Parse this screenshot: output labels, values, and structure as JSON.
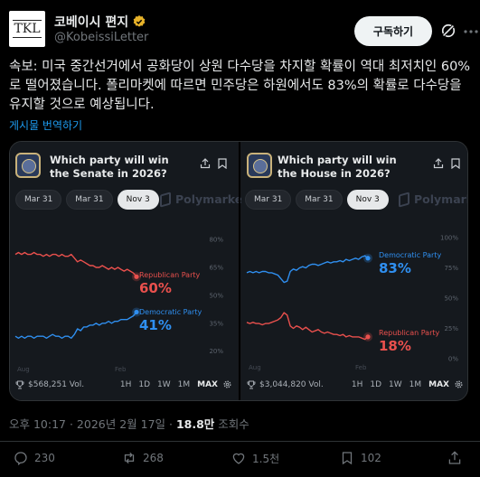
{
  "author": {
    "avatar_text": "TKL",
    "display_name": "코베이시 편지",
    "handle": "@KobeissiLetter"
  },
  "follow_label": "구독하기",
  "tweet_text": "속보: 미국 중간선거에서 공화당이 상원 다수당을 차지할 확률이 역대 최저치인 60%로 떨어졌습니다. 폴리마켓에 따르면 민주당은 하원에서도 83%의 확률로 다수당을 유지할 것으로 예상됩니다.",
  "translate_label": "게시물 번역하기",
  "colors": {
    "republican": "#e9504d",
    "democratic": "#2f8ff0",
    "accent": "#1d9bf0"
  },
  "panels": [
    {
      "title": "Which party will win the Senate in 2026?",
      "pills": [
        "Mar 31",
        "Mar 31",
        "Nov 3"
      ],
      "active_pill": 2,
      "brand": "Polymarket",
      "volume": "$568,251 Vol.",
      "ranges": [
        "1H",
        "1D",
        "1W",
        "1M",
        "MAX"
      ],
      "active_range": "MAX"
    },
    {
      "title": "Which party will win the House in 2026?",
      "pills": [
        "Mar 31",
        "Mar 31",
        "Nov 3"
      ],
      "active_pill": 2,
      "brand": "Polymarket",
      "volume": "$3,044,820 Vol.",
      "ranges": [
        "1H",
        "1D",
        "1W",
        "1M",
        "MAX"
      ],
      "active_range": "MAX"
    }
  ],
  "chart_data": [
    {
      "type": "line",
      "title": "Which party will win the Senate in 2026?",
      "x_ticks": [
        "Aug",
        "Feb"
      ],
      "y_ticks": [
        "80%",
        "65%",
        "50%",
        "35%",
        "20%"
      ],
      "ylim": [
        15,
        82
      ],
      "grid": false,
      "series": [
        {
          "name": "Republican Party",
          "value_label": "60%",
          "color": "#e9504d",
          "values": [
            72,
            73,
            72,
            73,
            72,
            72,
            73,
            72,
            72,
            71,
            72,
            71,
            72,
            72,
            71,
            72,
            71,
            71,
            72,
            70,
            68,
            69,
            68,
            67,
            66,
            66,
            65,
            65,
            66,
            65,
            64,
            65,
            64,
            65,
            64,
            63,
            64,
            63,
            62,
            60
          ]
        },
        {
          "name": "Democratic Party",
          "value_label": "41%",
          "color": "#2f8ff0",
          "values": [
            28,
            27,
            28,
            27,
            28,
            28,
            27,
            28,
            28,
            28,
            27,
            28,
            29,
            28,
            28,
            27,
            28,
            28,
            27,
            29,
            32,
            31,
            33,
            33,
            34,
            34,
            35,
            34,
            35,
            35,
            36,
            35,
            36,
            36,
            37,
            37,
            37,
            38,
            39,
            41
          ]
        }
      ]
    },
    {
      "type": "line",
      "title": "Which party will win the House in 2026?",
      "x_ticks": [
        "Aug",
        "Feb"
      ],
      "y_ticks": [
        "100%",
        "75%",
        "50%",
        "25%",
        "0%"
      ],
      "ylim": [
        0,
        100
      ],
      "grid": false,
      "series": [
        {
          "name": "Democratic Party",
          "value_label": "83%",
          "color": "#2f8ff0",
          "values": [
            71,
            72,
            71,
            72,
            71,
            72,
            72,
            71,
            71,
            70,
            69,
            66,
            63,
            64,
            72,
            74,
            73,
            75,
            76,
            75,
            77,
            78,
            78,
            77,
            78,
            79,
            80,
            79,
            80,
            80,
            81,
            80,
            82,
            81,
            82,
            83,
            82,
            84,
            85,
            83
          ]
        },
        {
          "name": "Republican Party",
          "value_label": "18%",
          "color": "#e9504d",
          "values": [
            30,
            29,
            30,
            29,
            29,
            28,
            29,
            29,
            30,
            31,
            32,
            34,
            38,
            36,
            27,
            25,
            27,
            26,
            24,
            26,
            24,
            22,
            23,
            24,
            22,
            21,
            22,
            21,
            20,
            20,
            19,
            20,
            18,
            19,
            18,
            18,
            18,
            17,
            16,
            18
          ]
        }
      ]
    }
  ],
  "meta": {
    "time": "오후 10:17 · 2026년 2월 17일 · ",
    "views": "18.8만",
    "views_suffix": " 조회수"
  },
  "actions": {
    "replies": "230",
    "reposts": "268",
    "likes": "1.5천",
    "bookmarks": "102"
  }
}
